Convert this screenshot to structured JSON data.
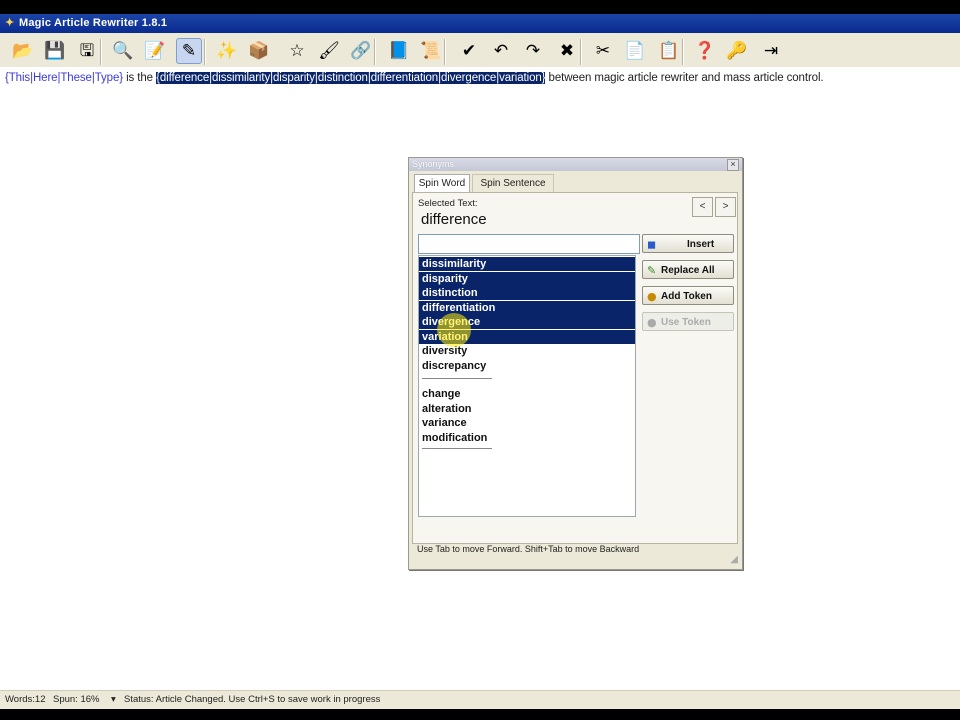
{
  "app": {
    "title": "Magic Article Rewriter 1.8.1",
    "accent_color": "#0a246a"
  },
  "toolbar": {
    "buttons": [
      {
        "name": "open-folder-icon",
        "glyph": "📂"
      },
      {
        "name": "save-icon",
        "glyph": "💾"
      },
      {
        "name": "save-as-icon",
        "glyph": "🖫"
      },
      {
        "name": "print-preview-icon",
        "glyph": "🔍"
      },
      {
        "name": "edit-note-icon",
        "glyph": "📝"
      },
      {
        "name": "pen-icon",
        "glyph": "✎"
      },
      {
        "name": "magic-wand-icon",
        "glyph": "✨"
      },
      {
        "name": "package-icon",
        "glyph": "📦"
      },
      {
        "name": "star-icon",
        "glyph": "☆"
      },
      {
        "name": "brush-icon",
        "glyph": "🖌"
      },
      {
        "name": "link-icon",
        "glyph": "🔗"
      },
      {
        "name": "book-icon",
        "glyph": "📘"
      },
      {
        "name": "certificate-icon",
        "glyph": "📜"
      },
      {
        "name": "check-document-icon",
        "glyph": "✔"
      },
      {
        "name": "undo-icon",
        "glyph": "↶"
      },
      {
        "name": "redo-icon",
        "glyph": "↷"
      },
      {
        "name": "delete-icon",
        "glyph": "✖"
      },
      {
        "name": "cut-icon",
        "glyph": "✂"
      },
      {
        "name": "copy-icon",
        "glyph": "📄"
      },
      {
        "name": "paste-icon",
        "glyph": "📋"
      },
      {
        "name": "help-icon",
        "glyph": "❓"
      },
      {
        "name": "key-icon",
        "glyph": "🔑"
      },
      {
        "name": "exit-icon",
        "glyph": "⇥"
      }
    ]
  },
  "editor": {
    "token_text": "{This|Here|These|Type}",
    "plain_1": " is the ",
    "selected_text": "{difference|dissimilarity|disparity|distinction|differentiation|divergence|variation}",
    "plain_2": " between magic article rewriter and mass article control."
  },
  "statusbar": {
    "words": "Words:12",
    "spun": "Spun: 16%",
    "dropdown_glyph": "▾",
    "status": "Status: Article Changed. Use Ctrl+S to save work in progress"
  },
  "dialog": {
    "title": "Synonyms",
    "close_glyph": "×",
    "tabs": [
      "Spin Word",
      "Spin Sentence"
    ],
    "selected_text_label": "Selected Text:",
    "selected_text_value": "difference",
    "prev_glyph": "<",
    "next_glyph": ">",
    "input_value": "",
    "list_items": [
      {
        "text": "dissimilarity",
        "selected": true
      },
      {
        "text": "disparity",
        "selected": true
      },
      {
        "text": "distinction",
        "selected": true
      },
      {
        "text": "differentiation",
        "selected": true
      },
      {
        "text": "divergence",
        "selected": true
      },
      {
        "text": "variation",
        "selected": true
      },
      {
        "text": "diversity",
        "selected": false
      },
      {
        "text": "discrepancy",
        "selected": false
      },
      {
        "text": "change",
        "selected": false
      },
      {
        "text": "alteration",
        "selected": false
      },
      {
        "text": "variance",
        "selected": false
      },
      {
        "text": "modification",
        "selected": false
      }
    ],
    "buttons": {
      "insert": "Insert",
      "replace_all": "Replace All",
      "add_token": "Add Token",
      "use_token": "Use Token"
    },
    "status": "Use Tab to move Forward.   Shift+Tab to move Backward"
  }
}
